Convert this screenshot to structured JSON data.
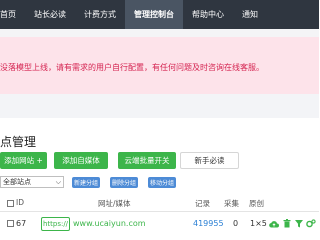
{
  "nav": {
    "items": [
      {
        "label": "首页",
        "active": false
      },
      {
        "label": "站长必读",
        "active": false
      },
      {
        "label": "计费方式",
        "active": false
      },
      {
        "label": "管理控制台",
        "active": true
      },
      {
        "label": "帮助中心",
        "active": false
      },
      {
        "label": "通知",
        "active": false
      }
    ]
  },
  "alert": {
    "text": "没落模型上线，请有需求的用户自行配置，有任何问题及时咨询在线客服。"
  },
  "page": {
    "title": "点管理"
  },
  "toolbar": {
    "add_site_label": "添加网站 +",
    "add_media_label": "添加自媒体",
    "cloud_bulk_label": "云端批量开关",
    "newbie_label": "新手必读"
  },
  "filter": {
    "select_value": "全部站点",
    "new_group_label": "新建分组",
    "delete_group_label": "删除分组",
    "move_group_label": "移动分组"
  },
  "table": {
    "columns": {
      "id": "ID",
      "site": "网址/媒体",
      "records": "记录",
      "collect": "采集",
      "rule": "原创"
    },
    "rows": [
      {
        "id": "67",
        "protocol": "https://",
        "site": "www.ucaiyun.com",
        "records": "419955",
        "collect": "0",
        "rule": "1×5"
      }
    ]
  },
  "colors": {
    "nav_bg": "#2f3640",
    "alert_bg": "#fde3ea",
    "alert_text": "#d52451",
    "accent_green": "#3cb54a",
    "accent_blue": "#4d8bd6",
    "record_blue": "#2a7fd4"
  },
  "icons": [
    "cloud-upload-icon",
    "trash-icon",
    "filter-icon",
    "settings-icon",
    "chevron-down-icon"
  ]
}
